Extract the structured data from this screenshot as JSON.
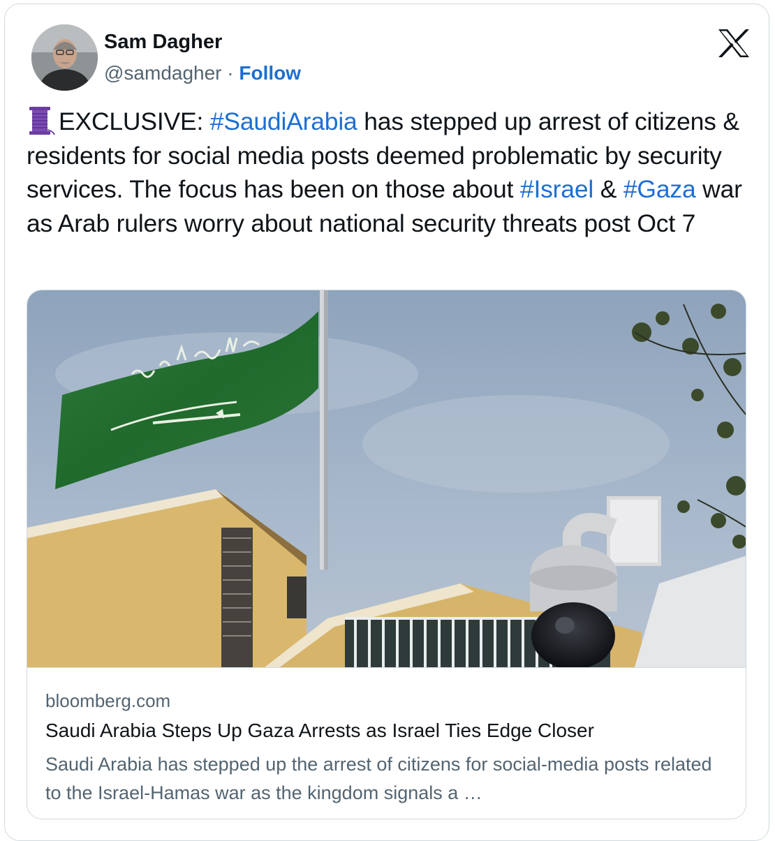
{
  "author": {
    "name": "Sam Dagher",
    "handle": "@samdagher",
    "separator": "·",
    "follow_label": "Follow"
  },
  "brand_icon": "x-logo-icon",
  "tweet": {
    "emoji_icon": "thread-spool-icon",
    "t1": "EXCLUSIVE: ",
    "h1": "#SaudiArabia",
    "t2": " has stepped up arrest of citizens & residents for social media posts deemed problematic by security services. The focus has been on those about ",
    "h2": "#Israel",
    "t3": " & ",
    "h3": "#Gaza",
    "t4": " war as Arab rulers worry about national security threats post Oct 7"
  },
  "link_card": {
    "domain": "bloomberg.com",
    "headline": "Saudi Arabia Steps Up Gaza Arrests as Israel Ties Edge Closer",
    "description": "Saudi Arabia has stepped up the arrest of citizens for social-media posts related to the Israel-Hamas war as the kingdom signals a …",
    "image_alt": "saudi-flag-and-security-camera-photo"
  },
  "colors": {
    "link": "#1d6fd1",
    "text": "#0f1419",
    "secondary": "#536471",
    "border": "#cfd9de"
  }
}
